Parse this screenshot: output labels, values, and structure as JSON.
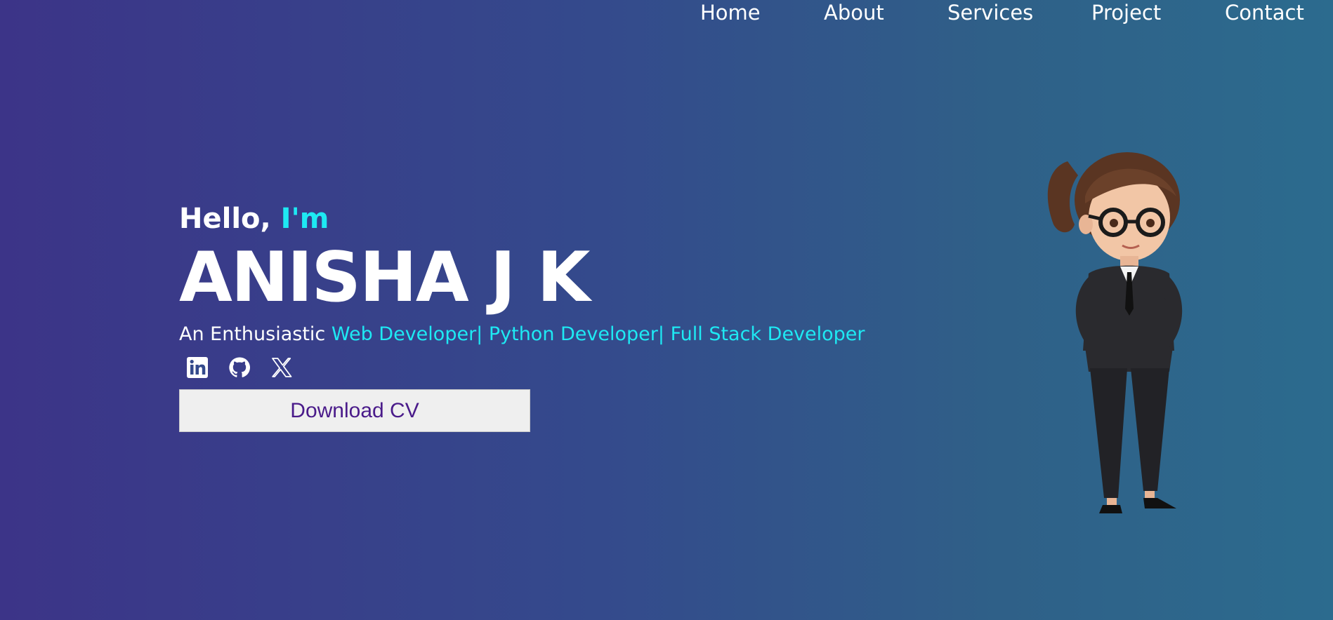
{
  "nav": {
    "items": [
      {
        "label": "Home"
      },
      {
        "label": "About"
      },
      {
        "label": "Services"
      },
      {
        "label": "Project"
      },
      {
        "label": "Contact"
      }
    ]
  },
  "hero": {
    "greeting": "Hello,",
    "greeting_accent": "I'm",
    "name": "ANISHA J K",
    "tagline_prefix": "An Enthusiastic",
    "tagline_roles": "Web Developer| Python Developer| Full Stack Developer",
    "cv_button_label": "Download CV"
  },
  "socials": [
    {
      "icon": "linkedin-icon"
    },
    {
      "icon": "github-icon"
    },
    {
      "icon": "x-icon"
    }
  ],
  "colors": {
    "accent": "#1ee9f3",
    "bg_start": "#3c3488",
    "bg_end": "#2c6b8e",
    "button_text": "#4a1b8a"
  },
  "avatar": {
    "icon": "avatar-illustration"
  }
}
